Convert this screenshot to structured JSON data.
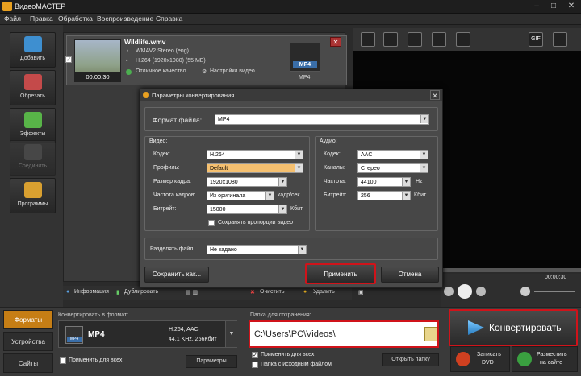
{
  "window": {
    "title": "ВидеоМАСТЕР",
    "minimize": "–",
    "maximize": "□",
    "close": "✕"
  },
  "menu": [
    "Файл",
    "Правка",
    "Обработка",
    "Воспроизведение",
    "Справка"
  ],
  "left_panel": [
    {
      "label": "Добавить",
      "color": "#3e8fd0"
    },
    {
      "label": "Обрезать",
      "color": "#c44a4a"
    },
    {
      "label": "Эффекты",
      "color": "#58b448"
    },
    {
      "label": "Соединить",
      "color": "#555555"
    },
    {
      "label": "Программы",
      "color": "#d9a030"
    }
  ],
  "file": {
    "name": "Wildlife.wmv",
    "audio": "WMAV2 Stereo (eng)",
    "video": "H.264 (1920x1080) (55 MБ)",
    "quality": "Отличное качество",
    "settings": "Настройки видео",
    "time": "00:00:30",
    "format_badge": "MP4",
    "format_label": "MP4",
    "close": "✕"
  },
  "toolbar2": {
    "info": "Информация",
    "duplicate": "Дублировать",
    "clear": "Очистить",
    "delete": "Удалить"
  },
  "preview": {
    "time": "00:00:30",
    "gif": "GIF"
  },
  "dialog": {
    "title": "Параметры конвертирования",
    "close": "✕",
    "format_label": "Формат файла:",
    "format_value": "MP4",
    "video_group": "Видео:",
    "audio_group": "Аудио:",
    "codec_label": "Кодек:",
    "codec_value": "H.264",
    "profile_label": "Профиль:",
    "profile_value": "Default",
    "size_label": "Размер кадра:",
    "size_value": "1920x1080",
    "fps_label": "Частота кадров:",
    "fps_value": "Из оригинала",
    "fps_unit": "кадр/сек.",
    "vbitrate_label": "Битрейт:",
    "vbitrate_value": "15000",
    "vbitrate_unit": "Кбит",
    "keep_aspect": "Сохранять пропорции видео",
    "acodec_label": "Кодек:",
    "acodec_value": "AAC",
    "channels_label": "Каналы:",
    "channels_value": "Стерео",
    "freq_label": "Частота:",
    "freq_value": "44100",
    "freq_unit": "Hz",
    "abitrate_label": "Битрейт:",
    "abitrate_value": "256",
    "abitrate_unit": "Кбит",
    "split_label": "Разделять файл:",
    "split_value": "Не задано",
    "save_as": "Сохранить как...",
    "apply": "Применить",
    "cancel": "Отмена"
  },
  "bottom": {
    "tabs": [
      "Форматы",
      "Устройства",
      "Сайты"
    ],
    "convert_to_label": "Конвертировать в формат:",
    "format_name": "MP4",
    "format_badge": "MP4",
    "format_codec": "H.264, AAC",
    "format_audio": "44,1 KHz, 256Кбит",
    "apply_all": "Применить для всех",
    "params": "Параметры",
    "save_folder_label": "Папка для сохранения:",
    "save_path": "C:\\Users\\PC\\Videos\\",
    "apply_all2": "Применить для всех",
    "source_folder": "Папка с исходным файлом",
    "open_folder": "Открыть папку",
    "convert": "Конвертировать",
    "burn_dvd_1": "Записать",
    "burn_dvd_2": "DVD",
    "publish_1": "Разместить",
    "publish_2": "на сайте"
  },
  "highlight_color": "#d0131a"
}
